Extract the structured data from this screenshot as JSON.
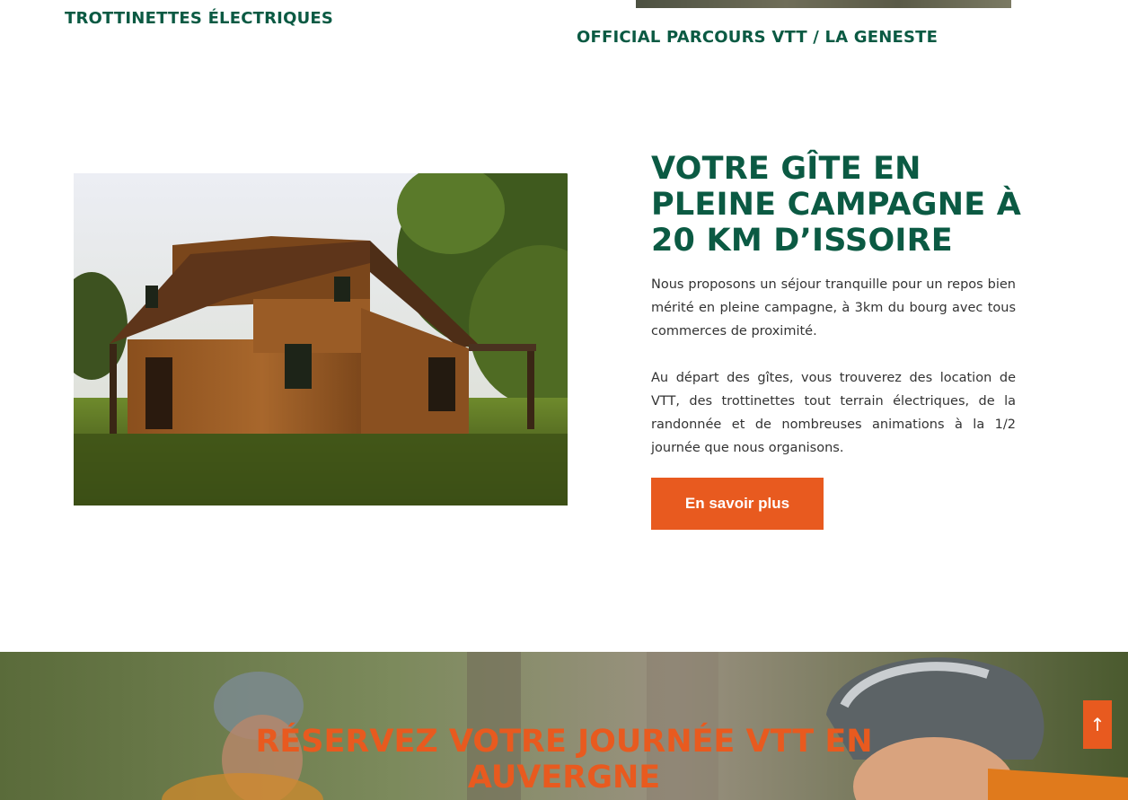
{
  "cards": {
    "left_title": "TROTTINETTES ÉLECTRIQUES",
    "right_title": "OFFICIAL PARCOURS VTT / LA GENESTE"
  },
  "gite": {
    "heading": "VOTRE GÎTE EN PLEINE CAMPAGNE À 20 KM D’ISSOIRE",
    "paragraph_1": "Nous proposons un séjour tranquille pour un repos bien mérité en pleine campagne, à 3km du bourg avec tous commerces de proximité.",
    "paragraph_2": "Au départ des gîtes, vous trouverez des location de VTT, des trottinettes tout terrain électriques, de la randonnée et de nombreuses animations à la 1/2 journée que nous organisons.",
    "button_label": "En savoir plus"
  },
  "hero": {
    "title_line_1": "RÉSERVEZ VOTRE JOURNÉE VTT EN",
    "title_line_2": "AUVERGNE"
  },
  "scroll_top": {
    "icon": "arrow-up-icon",
    "glyph": "↑"
  },
  "colors": {
    "brand_green": "#0b5a43",
    "accent_orange": "#e85a1f",
    "body_text": "#333333"
  }
}
